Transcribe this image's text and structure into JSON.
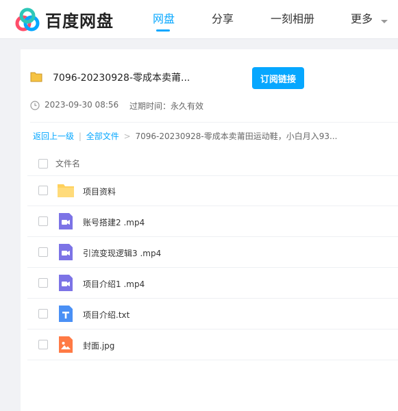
{
  "app": {
    "brand": "百度网盘",
    "accent": "#06a7ff"
  },
  "nav": [
    {
      "label": "网盘",
      "active": true
    },
    {
      "label": "分享",
      "active": false
    },
    {
      "label": "一刻相册",
      "active": false
    },
    {
      "label": "更多",
      "active": false
    }
  ],
  "share": {
    "title": "7096-20230928-零成本卖莆...",
    "subscribe_label": "订阅链接",
    "date": "2023-09-30 08:56",
    "expire": "过期时间：永久有效"
  },
  "breadcrumb": {
    "back": "返回上一级",
    "separator": "|",
    "all_files": "全部文件",
    "arrow": ">",
    "current": "7096-20230928-零成本卖莆田运动鞋，小白月入93..."
  },
  "table": {
    "column_header": "文件名",
    "files": [
      {
        "name": "项目资料",
        "icon": "folder-icon"
      },
      {
        "name": "账号搭建2 .mp4",
        "icon": "video-file-icon"
      },
      {
        "name": "引流变现逻辑3 .mp4",
        "icon": "video-file-icon"
      },
      {
        "name": "项目介绍1 .mp4",
        "icon": "video-file-icon"
      },
      {
        "name": "项目介绍.txt",
        "icon": "text-file-icon"
      },
      {
        "name": "封面.jpg",
        "icon": "image-file-icon"
      }
    ]
  },
  "colors": {
    "folder": "#ffd15c",
    "video": "#7c73e6",
    "text": "#4a90f5",
    "image": "#ff7a45"
  }
}
